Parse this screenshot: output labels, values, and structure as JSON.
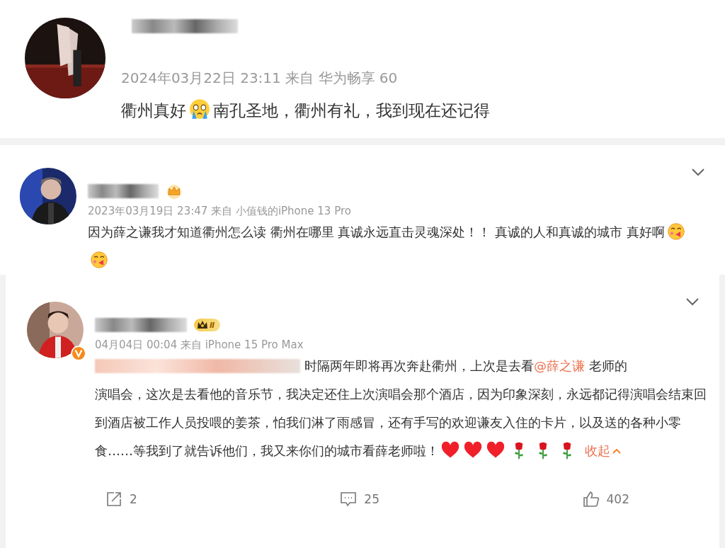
{
  "post": {
    "meta": "2024年03月22日 23:11  来自 华为畅享 60",
    "content": [
      {
        "kind": "text",
        "text": "衢州真好"
      },
      {
        "kind": "cry"
      },
      {
        "kind": "text",
        "text": "南孔圣地，衢州有礼，我到现在还记得"
      }
    ]
  },
  "comments": [
    {
      "meta": "2023年03月19日 23:47  来自 小值钱的iPhone 13 Pro",
      "badge": {
        "kind": "crown"
      },
      "verified": false,
      "content": [
        {
          "kind": "text",
          "text": "因为薛之谦我才知道衢州怎么读 衢州在哪里 真诚永远直击灵魂深处！！ 真诚的人和真诚的城市 真好啊"
        },
        {
          "kind": "kiss"
        },
        {
          "kind": "kiss"
        }
      ]
    },
    {
      "meta": "04月04日 00:04  来自 iPhone 15 Pro Max",
      "badge": {
        "kind": "level",
        "text": "Ⅱ"
      },
      "verified": true,
      "content": [
        {
          "kind": "blur"
        },
        {
          "kind": "text",
          "text": "时隔两年即将再次奔赴衢州，上次是去看"
        },
        {
          "kind": "mention",
          "text": "@薛之谦"
        },
        {
          "kind": "text",
          "text": " 老师的"
        },
        {
          "kind": "break"
        },
        {
          "kind": "text",
          "text": "演唱会，这次是去看他的音乐节，我决定还住上次演唱会那个酒店，因为印象深刻，永远都记得演唱会结束回到酒店被工作人员投喂的姜茶，怕我们淋了雨感冒，还有手写的欢迎谦友入住的卡片，以及送的各种小零食……等我到了就告诉他们，我又来你们的城市看薛老师啦！"
        },
        {
          "kind": "heart"
        },
        {
          "kind": "heart"
        },
        {
          "kind": "heart"
        },
        {
          "kind": "rose"
        },
        {
          "kind": "rose"
        },
        {
          "kind": "rose"
        },
        {
          "kind": "collapse",
          "text": "收起"
        }
      ],
      "actions": [
        {
          "kind": "share",
          "count": "2"
        },
        {
          "kind": "comment",
          "count": "25"
        },
        {
          "kind": "like",
          "count": "402"
        }
      ]
    }
  ]
}
